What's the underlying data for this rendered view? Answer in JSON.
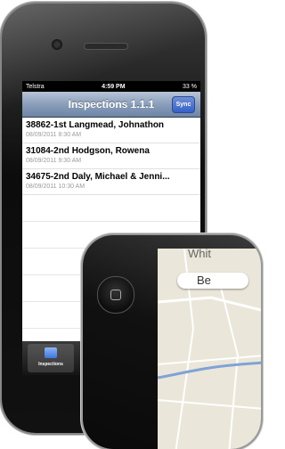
{
  "status_bar": {
    "left": "Telstra",
    "time": "4:59 PM",
    "battery": "33 %"
  },
  "nav": {
    "title": "Inspections 1.1.1",
    "sync_label": "Sync"
  },
  "inspections": [
    {
      "title": "38862-1st Langmead, Johnathon",
      "subtitle": "08/09/2011 8:30 AM"
    },
    {
      "title": "31084-2nd Hodgson, Rowena",
      "subtitle": "08/09/2011 9:30 AM"
    },
    {
      "title": "34675-2nd Daly, Michael & Jenni...",
      "subtitle": "08/09/2011 10:30 AM"
    }
  ],
  "tabbar": {
    "inspections_label": "Inspections"
  },
  "map": {
    "street_top": "Whit",
    "street_pill": "Be"
  },
  "colors": {
    "nav_blue": "#7f96b5",
    "sync_blue": "#3461c9",
    "map_bg": "#ebe6da"
  }
}
